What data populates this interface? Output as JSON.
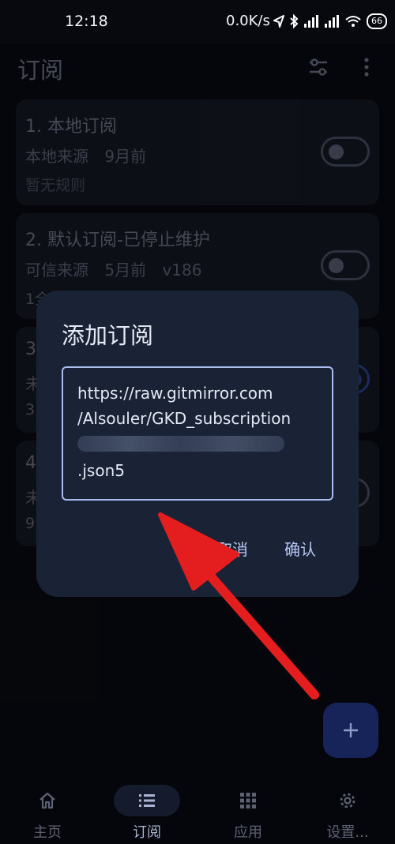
{
  "status_bar": {
    "time": "12:18",
    "network_speed": "0.0K/s",
    "battery": "66"
  },
  "header": {
    "title": "订阅"
  },
  "subscriptions": [
    {
      "title": "1. 本地订阅",
      "source": "本地来源",
      "updated": "9月前",
      "version": "",
      "rules": "暂无规则",
      "enabled": false
    },
    {
      "title": "2. 默认订阅-已停止维护",
      "source": "可信来源",
      "updated": "5月前",
      "version": "v186",
      "rules": "1全",
      "enabled": false
    },
    {
      "title": "3",
      "source": "未",
      "updated": "",
      "version": "",
      "rules": "3",
      "enabled": true
    },
    {
      "title": "4",
      "source": "未",
      "updated": "",
      "version": "",
      "rules": "9",
      "enabled": false
    }
  ],
  "dialog": {
    "title": "添加订阅",
    "url_lines": [
      "https://raw.gitmirror.com",
      "/Alsouler/GKD_subscription",
      ".json5"
    ],
    "cancel_label": "取消",
    "confirm_label": "确认"
  },
  "bottom_nav": [
    {
      "label": "主页",
      "icon": "home-icon"
    },
    {
      "label": "订阅",
      "icon": "list-icon"
    },
    {
      "label": "应用",
      "icon": "apps-grid-icon"
    },
    {
      "label": "设置...",
      "icon": "gear-icon"
    }
  ],
  "active_nav_index": 1,
  "colors": {
    "accent": "#a9bcf0",
    "annotation_arrow": "#e41e1e",
    "fab": "#16245a",
    "dialog_bg": "#1a2235"
  }
}
